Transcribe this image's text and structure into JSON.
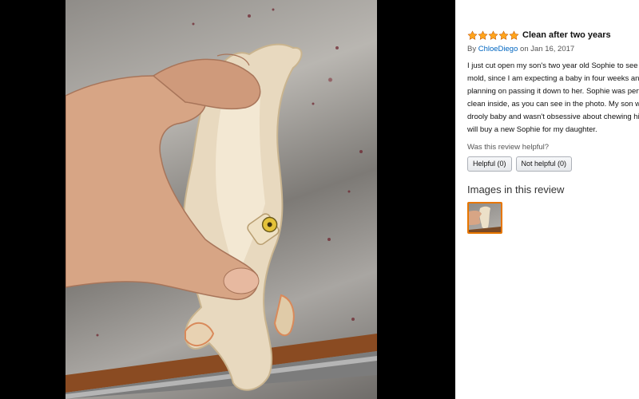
{
  "review": {
    "rating": 5,
    "title": "Clean after two years",
    "by_prefix": "By",
    "author": "ChloeDiego",
    "date_text": "on Jan 16, 2017",
    "body": "I just cut open my son's two year old Sophie to see if it had mold, since I am expecting a baby in four weeks and was planning on passing it down to her. Sophie was perfectly clean inside, as you can see in the photo. My son was not a drooly baby and wasn't obsessive about chewing his giraffe. I will buy a new Sophie for my daughter.",
    "helpful_question": "Was this review helpful?",
    "helpful_button": "Helpful (0)",
    "not_helpful_button": "Not helpful (0)",
    "images_heading": "Images in this review"
  },
  "icons": {
    "star": "star-icon"
  },
  "colors": {
    "star": "#ffa41c",
    "author_link": "#0066c0",
    "thumbnail_border": "#e77600"
  }
}
